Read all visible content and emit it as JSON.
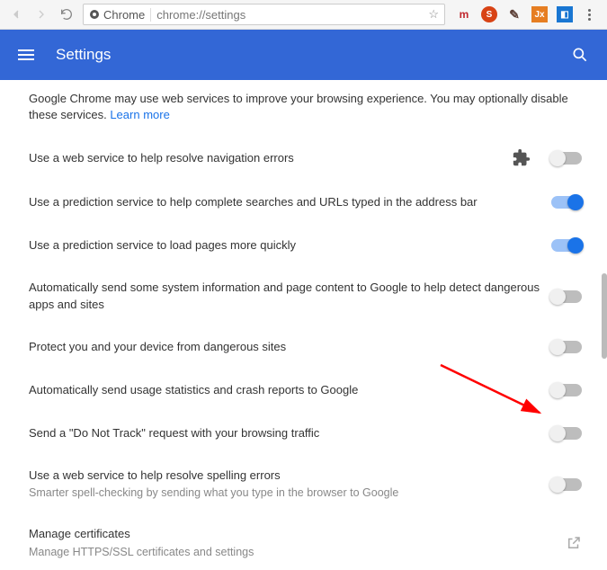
{
  "browser": {
    "app_label": "Chrome",
    "url": "chrome://settings"
  },
  "header": {
    "title": "Settings"
  },
  "intro": {
    "text_prefix": "Google Chrome may use web services to improve your browsing experience. You may optionally disable these services. ",
    "learn_more": "Learn more"
  },
  "rows": [
    {
      "label": "Use a web service to help resolve navigation errors",
      "sub": "",
      "on": false,
      "has_puzzle": true
    },
    {
      "label": "Use a prediction service to help complete searches and URLs typed in the address bar",
      "sub": "",
      "on": true,
      "has_puzzle": false
    },
    {
      "label": "Use a prediction service to load pages more quickly",
      "sub": "",
      "on": true,
      "has_puzzle": false
    },
    {
      "label": "Automatically send some system information and page content to Google to help detect dangerous apps and sites",
      "sub": "",
      "on": false,
      "has_puzzle": false
    },
    {
      "label": "Protect you and your device from dangerous sites",
      "sub": "",
      "on": false,
      "has_puzzle": false
    },
    {
      "label": "Automatically send usage statistics and crash reports to Google",
      "sub": "",
      "on": false,
      "has_puzzle": false
    },
    {
      "label": "Send a \"Do Not Track\" request with your browsing traffic",
      "sub": "",
      "on": false,
      "has_puzzle": false
    },
    {
      "label": "Use a web service to help resolve spelling errors",
      "sub": "Smarter spell-checking by sending what you type in the browser to Google",
      "on": false,
      "has_puzzle": false
    }
  ],
  "certs": {
    "label": "Manage certificates",
    "sub": "Manage HTTPS/SSL certificates and settings"
  }
}
